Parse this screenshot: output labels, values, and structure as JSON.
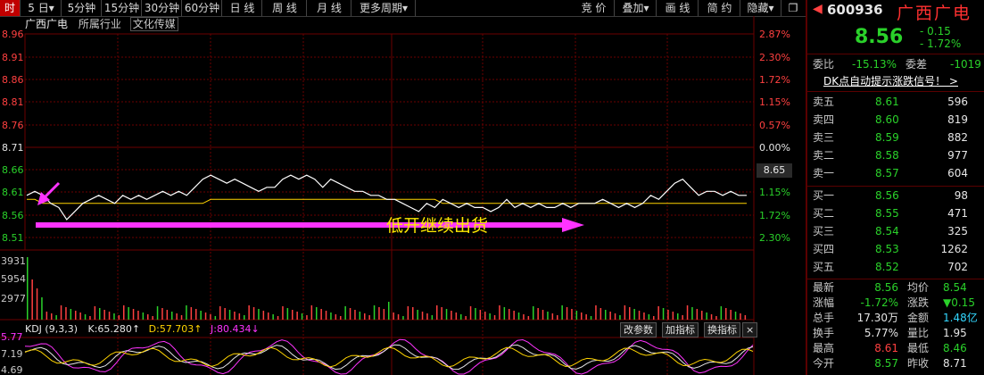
{
  "toolbar": {
    "tabs": [
      "时",
      "5 日▾",
      "5分钟",
      "15分钟",
      "30分钟",
      "60分钟",
      "日 线",
      "周 线",
      "月 线",
      "更多周期▾"
    ],
    "right_tabs": [
      "竞 价",
      "叠加▾",
      "画 线",
      "简 约",
      "隐藏▾"
    ]
  },
  "chart_header": {
    "name": "广西广电",
    "industry": "所属行业",
    "sector": "文化传媒"
  },
  "price_axis": [
    "8.96",
    "8.91",
    "8.86",
    "8.81",
    "8.76",
    "8.71",
    "8.66",
    "8.61",
    "8.56",
    "8.51"
  ],
  "pct_axis": [
    "2.87%",
    "2.30%",
    "1.72%",
    "1.15%",
    "0.57%",
    "0.00%",
    "",
    "1.15%",
    "1.72%",
    "2.30%"
  ],
  "current_price_tag": "8.65",
  "volume_axis": [
    "3931",
    "5954",
    "2977"
  ],
  "annotation": "低开继续出货",
  "kdj": {
    "label": "KDJ (9,3,3)",
    "k": "K:65.280↑",
    "d": "D:57.703↑",
    "j": "J:80.434↓",
    "buttons": [
      "改参数",
      "加指标",
      "换指标",
      "×"
    ],
    "axis": [
      "5.77",
      "7.19",
      "4.69"
    ]
  },
  "quote": {
    "code": "600936",
    "name": "广西广电",
    "price": "8.56",
    "change": "- 0.15",
    "change_pct": "- 1.72%",
    "weibi_label": "委比",
    "weibi": "-15.13%",
    "weicha_label": "委差",
    "weicha": "-1019",
    "signal": "DK点自动提示涨跌信号！ >",
    "asks": [
      {
        "label": "卖五",
        "price": "8.61",
        "vol": "596"
      },
      {
        "label": "卖四",
        "price": "8.60",
        "vol": "819"
      },
      {
        "label": "卖三",
        "price": "8.59",
        "vol": "882"
      },
      {
        "label": "卖二",
        "price": "8.58",
        "vol": "977"
      },
      {
        "label": "卖一",
        "price": "8.57",
        "vol": "604"
      }
    ],
    "bids": [
      {
        "label": "买一",
        "price": "8.56",
        "vol": "98"
      },
      {
        "label": "买二",
        "price": "8.55",
        "vol": "471"
      },
      {
        "label": "买三",
        "price": "8.54",
        "vol": "325"
      },
      {
        "label": "买四",
        "price": "8.53",
        "vol": "1262"
      },
      {
        "label": "买五",
        "price": "8.52",
        "vol": "702"
      }
    ],
    "stats": [
      {
        "l1": "最新",
        "v1": "8.56",
        "l2": "均价",
        "v2": "8.54"
      },
      {
        "l1": "涨幅",
        "v1": "-1.72%",
        "l2": "涨跌",
        "v2": "▼0.15"
      },
      {
        "l1": "总手",
        "v1": "17.30万",
        "l2": "金额",
        "v2": "1.48亿"
      },
      {
        "l1": "换手",
        "v1": "5.77%",
        "l2": "量比",
        "v2": "1.95"
      },
      {
        "l1": "最高",
        "v1": "8.61",
        "l2": "最低",
        "v2": "8.46"
      },
      {
        "l1": "今开",
        "v1": "8.57",
        "l2": "昨收",
        "v2": "8.71"
      }
    ]
  },
  "colors": {
    "up": "#ff4040",
    "down": "#2ad12a",
    "price_line": "#ffffff",
    "avg_line": "#ffd400",
    "arrow": "#ff33ff",
    "grid": "#6b0000"
  },
  "chart_data": {
    "type": "line",
    "series": [
      {
        "values": [
          8.56,
          8.57,
          8.56,
          8.54,
          8.53,
          8.5,
          8.52,
          8.54,
          8.55,
          8.56,
          8.55,
          8.54,
          8.56,
          8.55,
          8.56,
          8.55,
          8.56,
          8.57,
          8.56,
          8.57,
          8.56,
          8.58,
          8.6,
          8.61,
          8.6,
          8.59,
          8.6,
          8.59,
          8.58,
          8.57,
          8.58,
          8.58,
          8.6,
          8.61,
          8.6,
          8.61,
          8.6,
          8.58,
          8.6,
          8.59,
          8.58,
          8.57,
          8.57,
          8.56,
          8.56,
          8.55,
          8.55,
          8.54,
          8.53,
          8.52,
          8.54,
          8.53,
          8.55,
          8.54,
          8.53,
          8.54,
          8.53,
          8.53,
          8.52,
          8.53,
          8.55,
          8.53,
          8.54,
          8.53,
          8.54,
          8.53,
          8.53,
          8.54,
          8.53,
          8.54,
          8.54,
          8.54,
          8.55,
          8.54,
          8.53,
          8.54,
          8.53,
          8.54,
          8.56,
          8.55,
          8.57,
          8.59,
          8.6,
          8.58,
          8.56,
          8.57,
          8.57,
          8.56,
          8.57,
          8.56,
          8.56
        ]
      },
      {
        "values": [
          8.55,
          8.55,
          8.54,
          8.54,
          8.54,
          8.54,
          8.54,
          8.54,
          8.54,
          8.54,
          8.54,
          8.54,
          8.54,
          8.54,
          8.54,
          8.54,
          8.54,
          8.54,
          8.54,
          8.54,
          8.54,
          8.54,
          8.54,
          8.55,
          8.55,
          8.55,
          8.55,
          8.55,
          8.55,
          8.55,
          8.55,
          8.55,
          8.55,
          8.55,
          8.55,
          8.55,
          8.55,
          8.55,
          8.55,
          8.55,
          8.55,
          8.55,
          8.55,
          8.55,
          8.55,
          8.55,
          8.55,
          8.55,
          8.55,
          8.55,
          8.55,
          8.55,
          8.54,
          8.54,
          8.54,
          8.54,
          8.54,
          8.54,
          8.54,
          8.54,
          8.54,
          8.54,
          8.54,
          8.54,
          8.54,
          8.54,
          8.54,
          8.54,
          8.54,
          8.54,
          8.54,
          8.54,
          8.54,
          8.54,
          8.54,
          8.54,
          8.54,
          8.54,
          8.54,
          8.54,
          8.54,
          8.54,
          8.54,
          8.54,
          8.54,
          8.54,
          8.54,
          8.54,
          8.54,
          8.54,
          8.54
        ]
      }
    ],
    "ylim": [
      8.46,
      8.96
    ]
  }
}
